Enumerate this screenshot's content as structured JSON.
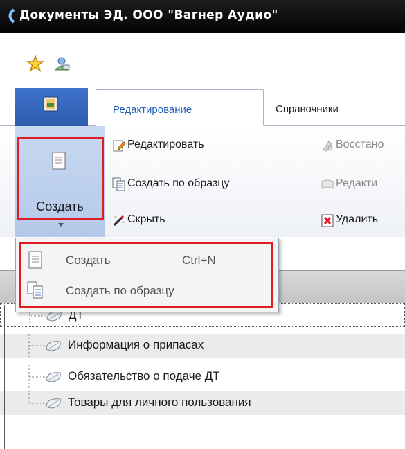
{
  "window": {
    "title": "Документы ЭД. ООО \"Вагнер Аудио\""
  },
  "quick_access": [
    {
      "icon": "star-icon"
    },
    {
      "icon": "search-person-icon"
    }
  ],
  "ribbon": {
    "tabs": [
      {
        "label": "Редактирование",
        "active": true
      },
      {
        "label": "Справочники",
        "active": false
      }
    ],
    "create_button": {
      "label": "Создать"
    },
    "buttons": [
      {
        "label": "Редактировать",
        "icon": "edit-icon",
        "enabled": true
      },
      {
        "label": "Создать по образцу",
        "icon": "copy-document-icon",
        "enabled": true
      },
      {
        "label": "Скрыть",
        "icon": "magic-wand-icon",
        "enabled": true
      },
      {
        "label": "Восстано",
        "icon": "restore-icon",
        "enabled": false
      },
      {
        "label": "Редакти",
        "icon": "document-edit-icon",
        "enabled": false
      },
      {
        "label": "Удалить",
        "icon": "delete-icon",
        "enabled": true
      }
    ]
  },
  "dropdown_menu": {
    "items": [
      {
        "label": "Создать",
        "shortcut": "Ctrl+N",
        "icon": "new-document-icon"
      },
      {
        "label": "Создать по образцу",
        "shortcut": "",
        "icon": "copy-document-icon"
      }
    ]
  },
  "tree": {
    "items": [
      {
        "label": "ДТ"
      },
      {
        "label": "Информация о припасах"
      },
      {
        "label": "Обязательство о подаче ДТ"
      },
      {
        "label": "Товары для личного пользования"
      }
    ]
  },
  "colors": {
    "title_bar": "#0a0a0a",
    "accent_blue": "#2d5cae",
    "active_tab_text": "#1d5fb8",
    "highlight_frame": "#e31b23",
    "create_button_bg": "#b4c9ea"
  }
}
